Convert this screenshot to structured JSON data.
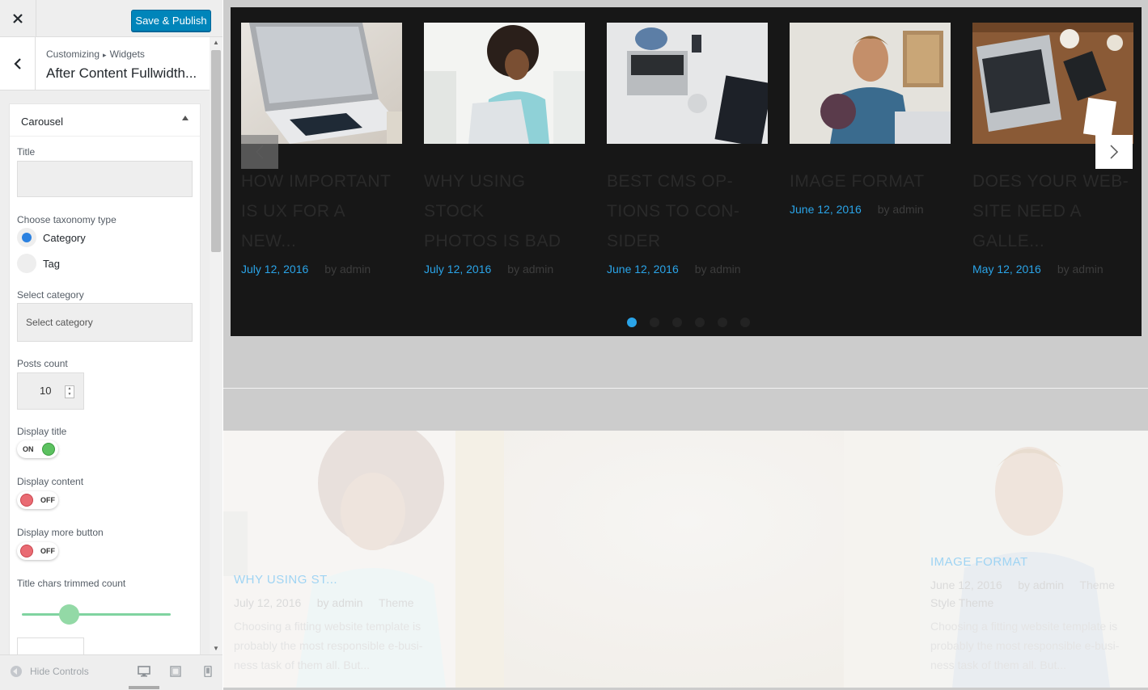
{
  "customizer": {
    "close_icon": "close-icon",
    "save_label": "Save & Publish",
    "breadcrumb": {
      "root": "Customizing",
      "separator": "▸",
      "section": "Widgets"
    },
    "panel_title": "After Content Fullwidth...",
    "widget": {
      "name": "Carousel",
      "title_label": "Title",
      "title_value": "",
      "taxonomy_label": "Choose taxonomy type",
      "taxonomy_options": [
        "Category",
        "Tag"
      ],
      "taxonomy_selected": "Category",
      "category_label": "Select category",
      "category_value": "Select category",
      "posts_count_label": "Posts count",
      "posts_count_value": "10",
      "display_title_label": "Display title",
      "display_title_state": "ON",
      "display_content_label": "Display content",
      "display_content_state": "OFF",
      "display_more_label": "Display more button",
      "display_more_state": "OFF",
      "trim_label": "Title chars trimmed count",
      "trim_slider_level": 0.32
    },
    "footer": {
      "hide_controls": "Hide Controls"
    },
    "colors": {
      "primary": "#0085ba",
      "toggle_on": "#5cc160",
      "toggle_off": "#e96b73",
      "radio": "#2b81e0"
    }
  },
  "preview": {
    "carousel": {
      "slides": [
        {
          "title_lines": [
            "HOW IMPORTANT",
            "IS UX FOR A NEW..."
          ],
          "date": "July 12, 2016",
          "author": "by admin",
          "image": "laptop-photo"
        },
        {
          "title_lines": [
            "WHY USING STOCK",
            "PHOTOS IS BAD"
          ],
          "date": "July 12, 2016",
          "author": "by admin",
          "image": "woman-laptop-photo"
        },
        {
          "title_lines": [
            "BEST CMS OP-",
            "TIONS TO CON-",
            "SIDER"
          ],
          "date": "June 12, 2016",
          "author": "by admin",
          "image": "desk-overhead-photo"
        },
        {
          "title_lines": [
            "IMAGE FORMAT"
          ],
          "date": "June 12, 2016",
          "author": "by admin",
          "image": "man-phone-photo"
        },
        {
          "title_lines": [
            "DOES YOUR WEB-",
            "SITE NEED A",
            "GALLE..."
          ],
          "date": "May 12, 2016",
          "author": "by admin",
          "image": "wood-desk-photo"
        }
      ],
      "active_dot": 0,
      "dot_count": 6,
      "accent": "#2aa4e8"
    },
    "grid": {
      "left_card": {
        "title": "WHY USING ST...",
        "date": "July 12, 2016",
        "author": "by admin",
        "tag": "Theme",
        "excerpt_lines": [
          "Choosing a fitting website template is",
          "probably the most responsible e-busi-",
          "ness task of them all. But..."
        ]
      },
      "right_card": {
        "title": "IMAGE FORMAT",
        "date": "June 12, 2016",
        "author": "by admin",
        "tag": "Theme",
        "tags_line2": "Style  Theme",
        "excerpt_lines": [
          "Choosing a fitting website template is",
          "probably the most responsible e-busi-",
          "ness task of them all. But..."
        ]
      }
    }
  }
}
